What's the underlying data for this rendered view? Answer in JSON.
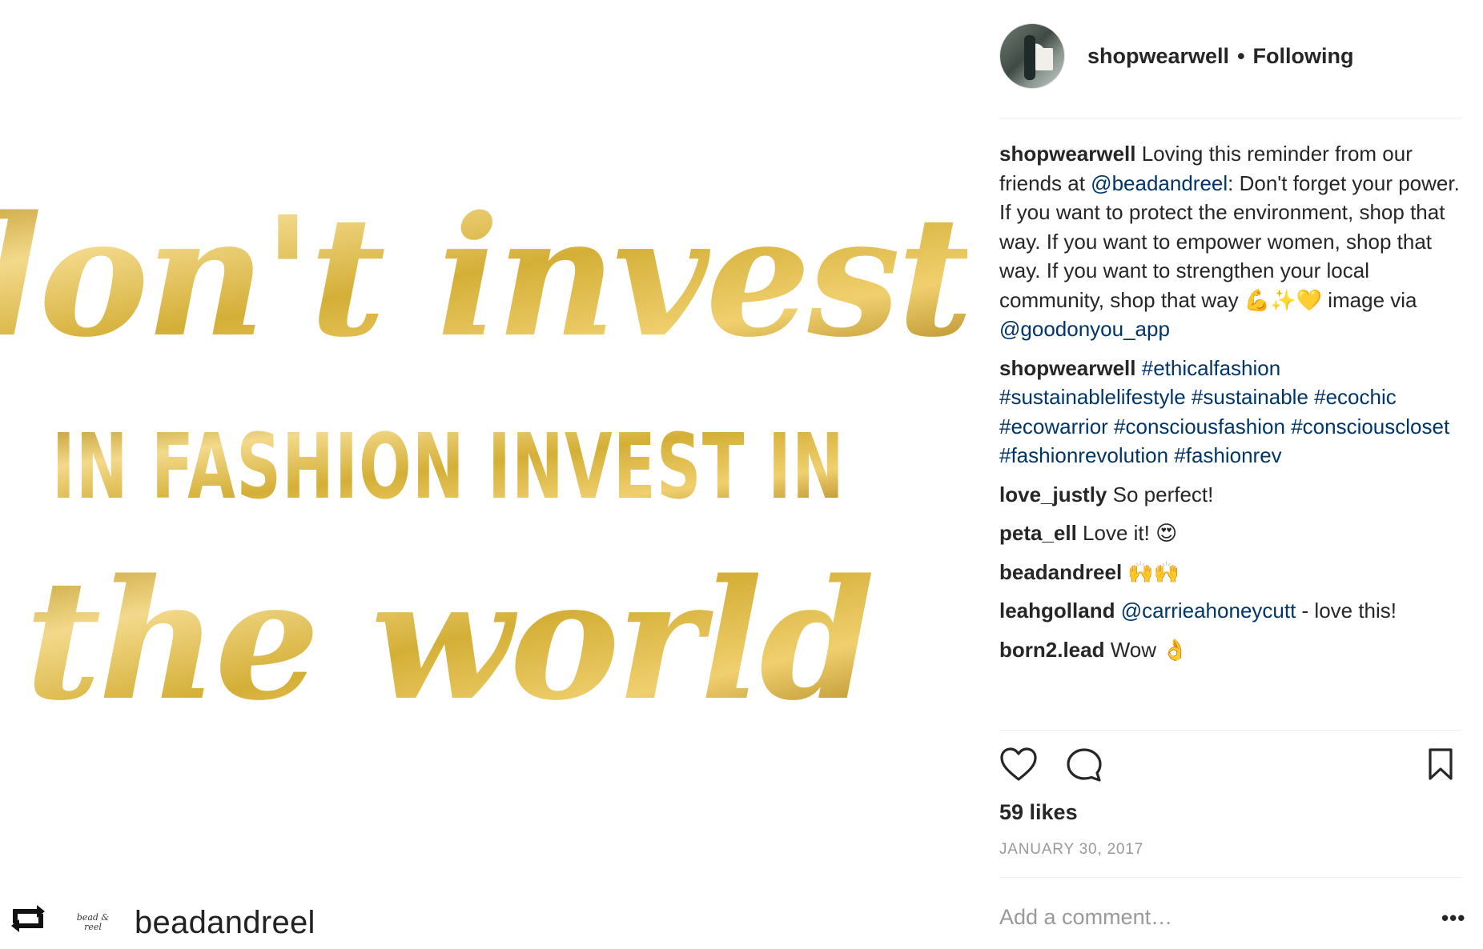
{
  "post_image": {
    "line1": "don't invest",
    "line2": "IN FASHION INVEST IN",
    "line3": "the world",
    "colors": {
      "gold": "#D4AF37",
      "gold_dark": "#B8901E",
      "gold_light": "#F3D98B"
    }
  },
  "repost": {
    "icon": "repost-icon",
    "logo_text": "bead & reel",
    "username": "beadandreel"
  },
  "header": {
    "username": "shopwearwell",
    "separator": "•",
    "follow_status": "Following"
  },
  "caption": {
    "username": "shopwearwell",
    "text_1": " Loving this reminder from our friends at ",
    "mention": "@beadandreel",
    "text_2": ": Don't forget your power. If you want to protect the environment, shop that way. If you want to empower women, shop that way. If you want to strengthen your local community, shop that way ",
    "emoji": "💪✨💛",
    "text_3": " image via ",
    "mention_2": "@goodonyou_app"
  },
  "hashtag_comment": {
    "username": "shopwearwell",
    "tags": "#ethicalfashion #sustainablelifestyle #sustainable #ecochic #ecowarrior #consciousfashion #consciouscloset #fashionrevolution #fashionrev"
  },
  "comments": [
    {
      "username": "love_justly",
      "text": " So perfect!"
    },
    {
      "username": "peta_ell",
      "text": " Love it! 😍"
    },
    {
      "username": "beadandreel",
      "text": " 🙌🙌"
    },
    {
      "username": "leahgolland",
      "mention": " @carrieahoneycutt",
      "text": " - love this!"
    },
    {
      "username": "born2.lead",
      "text": " Wow 👌"
    }
  ],
  "actions": {
    "like_icon": "heart-icon",
    "comment_icon": "comment-bubble-icon",
    "save_icon": "bookmark-icon"
  },
  "likes": "59 likes",
  "date": "JANUARY 30, 2017",
  "add_comment": {
    "placeholder": "Add a comment…"
  },
  "more_options": "•••",
  "colors": {
    "link": "#003569",
    "text": "#262626",
    "muted": "#999999",
    "divider": "#efefef"
  }
}
